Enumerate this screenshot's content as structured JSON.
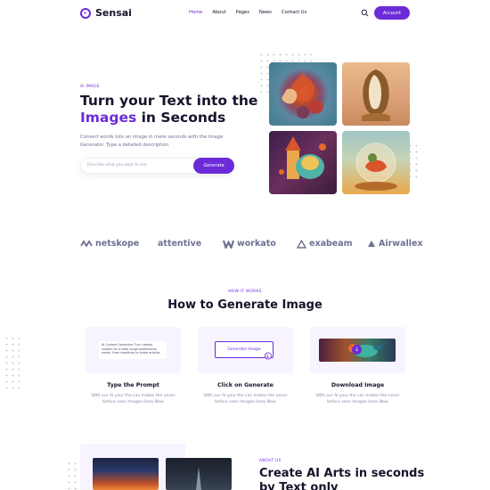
{
  "brand": {
    "name": "Sensai"
  },
  "nav": {
    "items": [
      "Home",
      "About",
      "Pages",
      "News",
      "Contact Us"
    ],
    "account": "Account"
  },
  "hero": {
    "tag": "AI IMAGE",
    "title_1": "Turn your Text into the",
    "title_hl": "Images",
    "title_2": " in Seconds",
    "desc": "Convert words into an image in mere seconds with the Image Generator. Type a detailed description",
    "placeholder": "Describe what you want to see",
    "button": "Generate"
  },
  "logos": [
    "netskope",
    "attentive",
    "workato",
    "exabeam",
    "Airwallex"
  ],
  "how": {
    "tag": "HOW IT WORKS",
    "title": "How to Generate Image",
    "card1_text": "AI Content Generator. Turn creates content for a wide range professional needs. From headlines to entire articles.",
    "card2_button": "Generate Image",
    "steps": [
      {
        "title": "Type the Prompt",
        "desc": "With our AI your the can makes the never before seen Images fores New"
      },
      {
        "title": "Click on Generate",
        "desc": "With our AI your the can makes the never before seen Images fores New"
      },
      {
        "title": "Download Image",
        "desc": "With our AI your the can makes the never before seen Images fores New"
      }
    ]
  },
  "about": {
    "tag": "ABOUT US",
    "title_1": "Create AI Arts in seconds",
    "title_2": "by Text only"
  },
  "colors": {
    "accent": "#6c2bd9",
    "text": "#14142b",
    "muted": "#6e7191",
    "card": "#f7f3ff"
  }
}
